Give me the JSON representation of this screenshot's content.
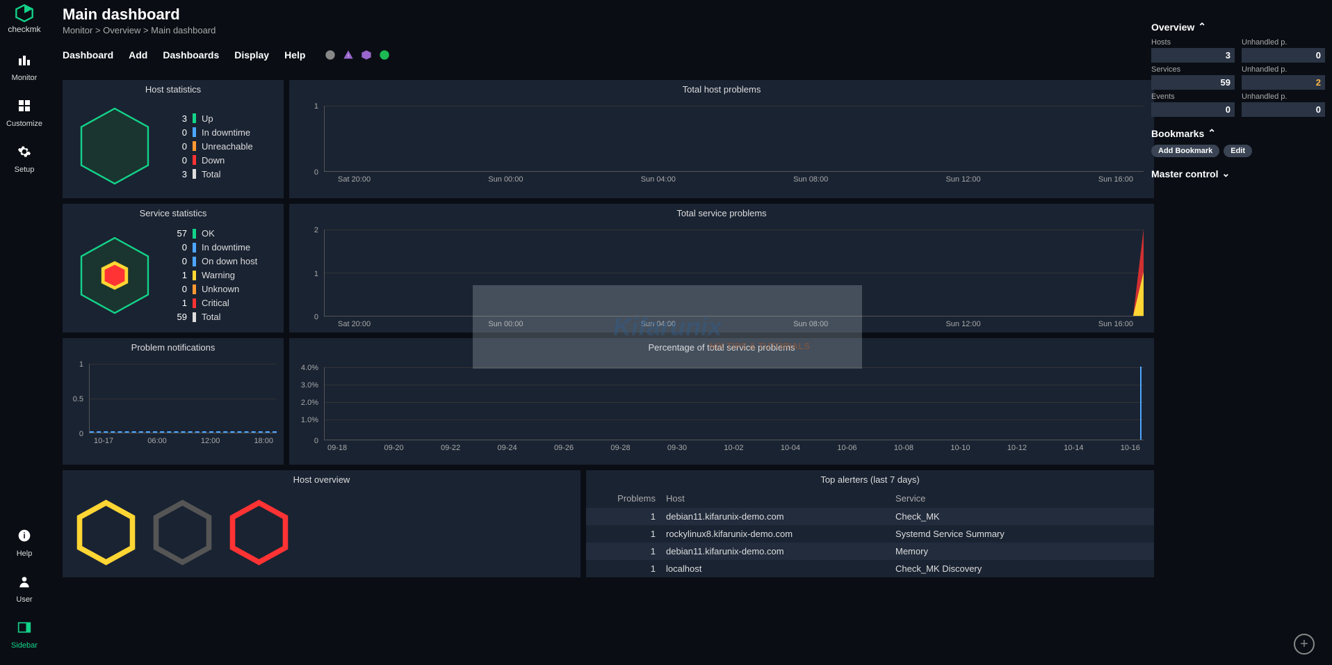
{
  "app_name": "checkmk",
  "sidebar": {
    "items": [
      {
        "icon": "bars",
        "label": "Monitor"
      },
      {
        "icon": "grid",
        "label": "Customize"
      },
      {
        "icon": "gear",
        "label": "Setup"
      }
    ],
    "bottom": [
      {
        "icon": "info",
        "label": "Help"
      },
      {
        "icon": "user",
        "label": "User"
      },
      {
        "icon": "sidebar",
        "label": "Sidebar"
      }
    ]
  },
  "header": {
    "title": "Main dashboard",
    "breadcrumb": "Monitor > Overview > Main dashboard"
  },
  "menubar": [
    "Dashboard",
    "Add",
    "Dashboards",
    "Display",
    "Help"
  ],
  "panels": {
    "host_stats": {
      "title": "Host statistics",
      "items": [
        {
          "count": 3,
          "color": "#13d389",
          "label": "Up"
        },
        {
          "count": 0,
          "color": "#4da6ff",
          "label": "In downtime"
        },
        {
          "count": 0,
          "color": "#ff9933",
          "label": "Unreachable"
        },
        {
          "count": 0,
          "color": "#ff3333",
          "label": "Down"
        },
        {
          "count": 3,
          "color": "#ddd",
          "label": "Total"
        }
      ]
    },
    "service_stats": {
      "title": "Service statistics",
      "items": [
        {
          "count": 57,
          "color": "#13d389",
          "label": "OK"
        },
        {
          "count": 0,
          "color": "#4da6ff",
          "label": "In downtime"
        },
        {
          "count": 0,
          "color": "#4da6ff",
          "label": "On down host"
        },
        {
          "count": 1,
          "color": "#ffd633",
          "label": "Warning"
        },
        {
          "count": 0,
          "color": "#ff9933",
          "label": "Unknown"
        },
        {
          "count": 1,
          "color": "#ff3333",
          "label": "Critical"
        },
        {
          "count": 59,
          "color": "#ddd",
          "label": "Total"
        }
      ]
    },
    "total_host_problems": {
      "title": "Total host problems"
    },
    "total_service_problems": {
      "title": "Total service problems"
    },
    "problem_notifications": {
      "title": "Problem notifications"
    },
    "pct_service_problems": {
      "title": "Percentage of total service problems"
    },
    "host_overview": {
      "title": "Host overview",
      "hosts": [
        {
          "color": "#ffd633"
        },
        {
          "color": "#555"
        },
        {
          "color": "#ff3333"
        }
      ]
    },
    "top_alerters": {
      "title": "Top alerters (last 7 days)",
      "headers": {
        "problems": "Problems",
        "host": "Host",
        "service": "Service"
      },
      "rows": [
        {
          "problems": 1,
          "host": "debian11.kifarunix-demo.com",
          "service": "Check_MK"
        },
        {
          "problems": 1,
          "host": "rockylinux8.kifarunix-demo.com",
          "service": "Systemd Service Summary"
        },
        {
          "problems": 1,
          "host": "debian11.kifarunix-demo.com",
          "service": "Memory"
        },
        {
          "problems": 1,
          "host": "localhost",
          "service": "Check_MK Discovery"
        }
      ]
    }
  },
  "rightbar": {
    "overview": {
      "title": "Overview",
      "stats": [
        {
          "label": "Hosts",
          "value": "3"
        },
        {
          "label": "Unhandled p.",
          "value": "0"
        },
        {
          "label": "Services",
          "value": "59"
        },
        {
          "label": "Unhandled p.",
          "value": "2",
          "warn": true
        },
        {
          "label": "Events",
          "value": "0"
        },
        {
          "label": "Unhandled p.",
          "value": "0"
        }
      ]
    },
    "bookmarks": {
      "title": "Bookmarks",
      "add": "Add Bookmark",
      "edit": "Edit"
    },
    "master_control": {
      "title": "Master control"
    }
  },
  "chart_data": [
    {
      "id": "total_host_problems",
      "type": "line",
      "title": "Total host problems",
      "x_ticks": [
        "Sat 20:00",
        "Sun 00:00",
        "Sun 04:00",
        "Sun 08:00",
        "Sun 12:00",
        "Sun 16:00"
      ],
      "y_ticks": [
        0,
        1
      ],
      "ylim": [
        0,
        1
      ],
      "series": [
        {
          "name": "problems",
          "values": [
            0,
            0,
            0,
            0,
            0,
            0,
            0
          ]
        }
      ]
    },
    {
      "id": "total_service_problems",
      "type": "area",
      "title": "Total service problems",
      "x_ticks": [
        "Sat 20:00",
        "Sun 00:00",
        "Sun 04:00",
        "Sun 08:00",
        "Sun 12:00",
        "Sun 16:00"
      ],
      "y_ticks": [
        0,
        1,
        2
      ],
      "ylim": [
        0,
        2
      ],
      "series": [
        {
          "name": "critical",
          "color": "#ff3333",
          "values": [
            0,
            0,
            0,
            0,
            0,
            0,
            2
          ]
        },
        {
          "name": "warning",
          "color": "#ffd633",
          "values": [
            0,
            0,
            0,
            0,
            0,
            0,
            1
          ]
        }
      ]
    },
    {
      "id": "problem_notifications",
      "type": "line",
      "title": "Problem notifications",
      "x_ticks": [
        "10-17",
        "06:00",
        "12:00",
        "18:00"
      ],
      "y_ticks": [
        0,
        0.5,
        1
      ],
      "ylim": [
        0,
        1
      ],
      "series": [
        {
          "name": "notifications",
          "values": [
            0,
            0,
            0,
            0
          ]
        }
      ]
    },
    {
      "id": "pct_service_problems",
      "type": "line",
      "title": "Percentage of total service problems",
      "x_ticks": [
        "09-18",
        "09-20",
        "09-22",
        "09-24",
        "09-26",
        "09-28",
        "09-30",
        "10-02",
        "10-04",
        "10-06",
        "10-08",
        "10-10",
        "10-12",
        "10-14",
        "10-16"
      ],
      "y_ticks": [
        "0",
        "1.0%",
        "2.0%",
        "3.0%",
        "4.0%"
      ],
      "ylim": [
        0,
        4
      ],
      "series": [
        {
          "name": "pct",
          "values": [
            0,
            0,
            0,
            0,
            0,
            0,
            0,
            0,
            0,
            0,
            0,
            0,
            0,
            0,
            4
          ]
        }
      ]
    }
  ],
  "watermark": {
    "main": "Kifarunix",
    "sub": "NIX TIPS & TUTORIALS"
  }
}
